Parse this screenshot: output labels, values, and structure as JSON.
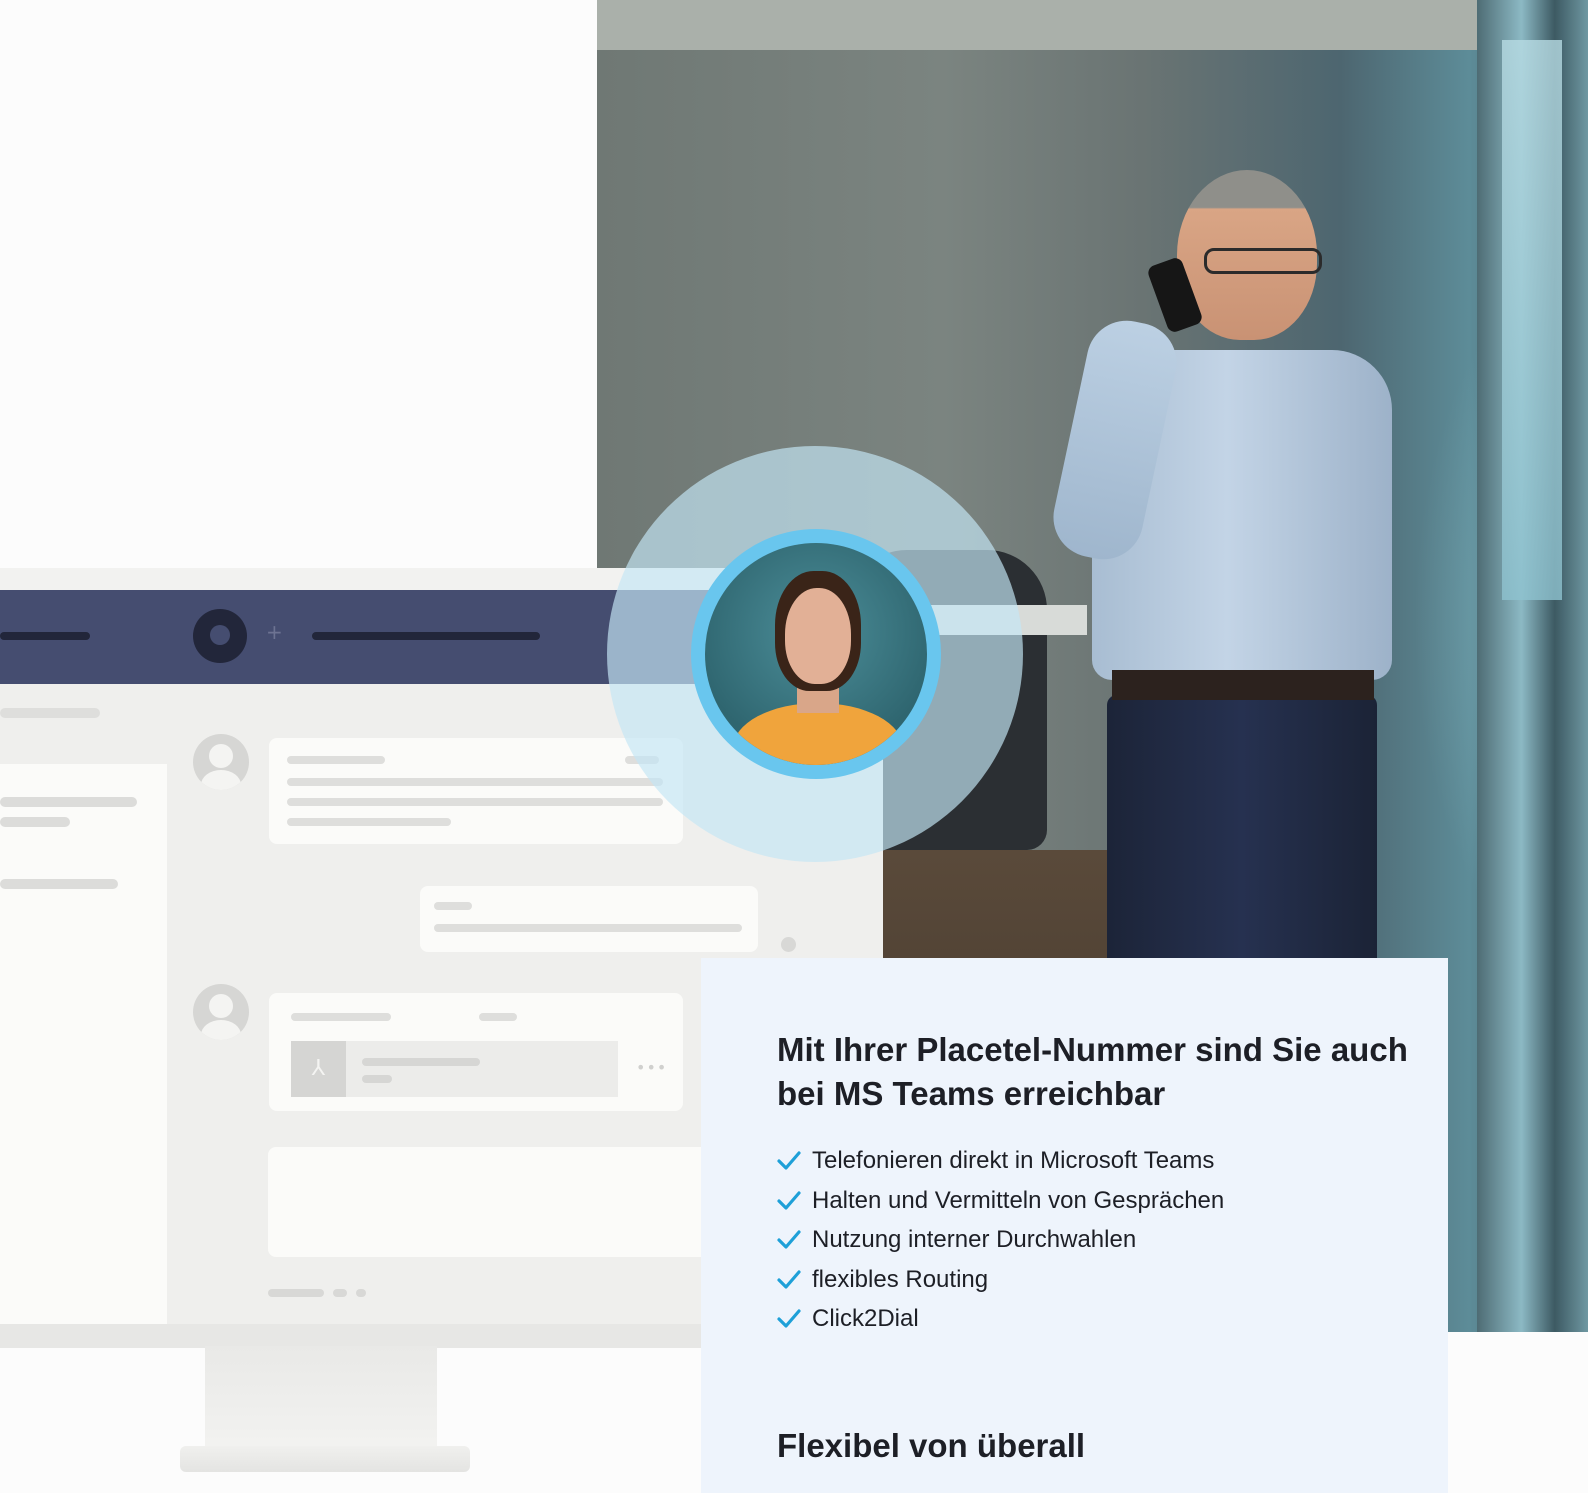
{
  "info_card": {
    "headline": "Mit Ihrer Placetel-Nummer sind Sie auch bei MS Teams erreichbar",
    "features": [
      "Telefonieren direkt in Microsoft Teams",
      "Halten und Vermitteln von Gesprächen",
      "Nutzung interner Durchwahlen",
      "flexibles Routing",
      "Click2Dial"
    ],
    "subheadline": "Flexibel von überall"
  },
  "icons": {
    "check": "check-icon",
    "app_logo": "chat-logo-icon",
    "plus": "plus-icon",
    "pdf": "pdf-file-icon",
    "more": "more-icon",
    "avatar": "avatar-placeholder-icon"
  },
  "colors": {
    "accent": "#1ea0d8",
    "teams_bar": "#454d70",
    "card_bg": "#eef4fc",
    "contact_ring": "#69c6ee"
  }
}
